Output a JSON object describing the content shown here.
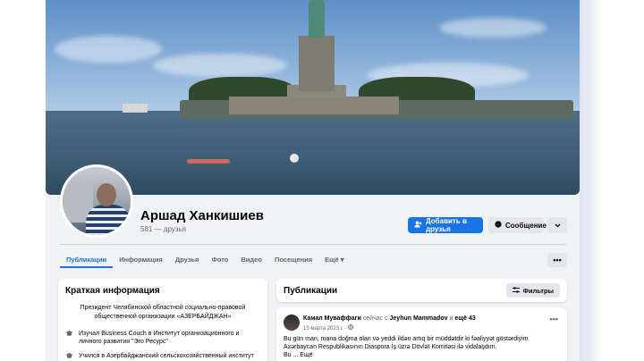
{
  "profile": {
    "name": "Аршад Ханкишиев",
    "friends": "581 — друзья"
  },
  "actions": {
    "add_friend": "Добавить в друзья",
    "message": "Сообщение",
    "more_icon": "chevron-down-icon"
  },
  "tabs": [
    {
      "label": "Публикации",
      "active": true
    },
    {
      "label": "Информация"
    },
    {
      "label": "Друзья"
    },
    {
      "label": "Фото"
    },
    {
      "label": "Видео"
    },
    {
      "label": "Посещения"
    },
    {
      "label": "Ещё ▾"
    }
  ],
  "tabs_more": "•••",
  "intro": {
    "title": "Краткая информация",
    "bio": "Президент Челябинской областной социально-правовой общественной организации «АЗЕРБАЙДЖАН»",
    "items": [
      {
        "icon": "graduation-cap-icon",
        "text": "Изучал Business Couch в Институт организационного и личного развития \"Эго Ресурс\""
      },
      {
        "icon": "graduation-cap-icon",
        "text": "Учился в Азербайджанский сельскохозяйственный институт"
      }
    ]
  },
  "posts": {
    "title": "Публикации",
    "filters_label": "Фильтры",
    "post": {
      "author": "Камал Муваффаги",
      "meta_middle": "сейчас с",
      "tagged": "Jeyhun Mammadov",
      "meta_and": "и",
      "others": "ещё 43",
      "date": "15 марта 2023 г. · ",
      "text": "Bu gün man, mana doğma olan və yeddi ildən artıq bir müddətdir ki fəaliyyət göstərdiyim Azərbaycan Respublikasının Diaspora İş üzrə Dövlət Komitəsi ilə vidalaşdım.",
      "more": "Bu ... Ещё"
    }
  },
  "colors": {
    "accent": "#1b74e4",
    "background": "#f0f2f5",
    "secondary_button": "#e4e6eb",
    "muted_text": "#65676b"
  }
}
